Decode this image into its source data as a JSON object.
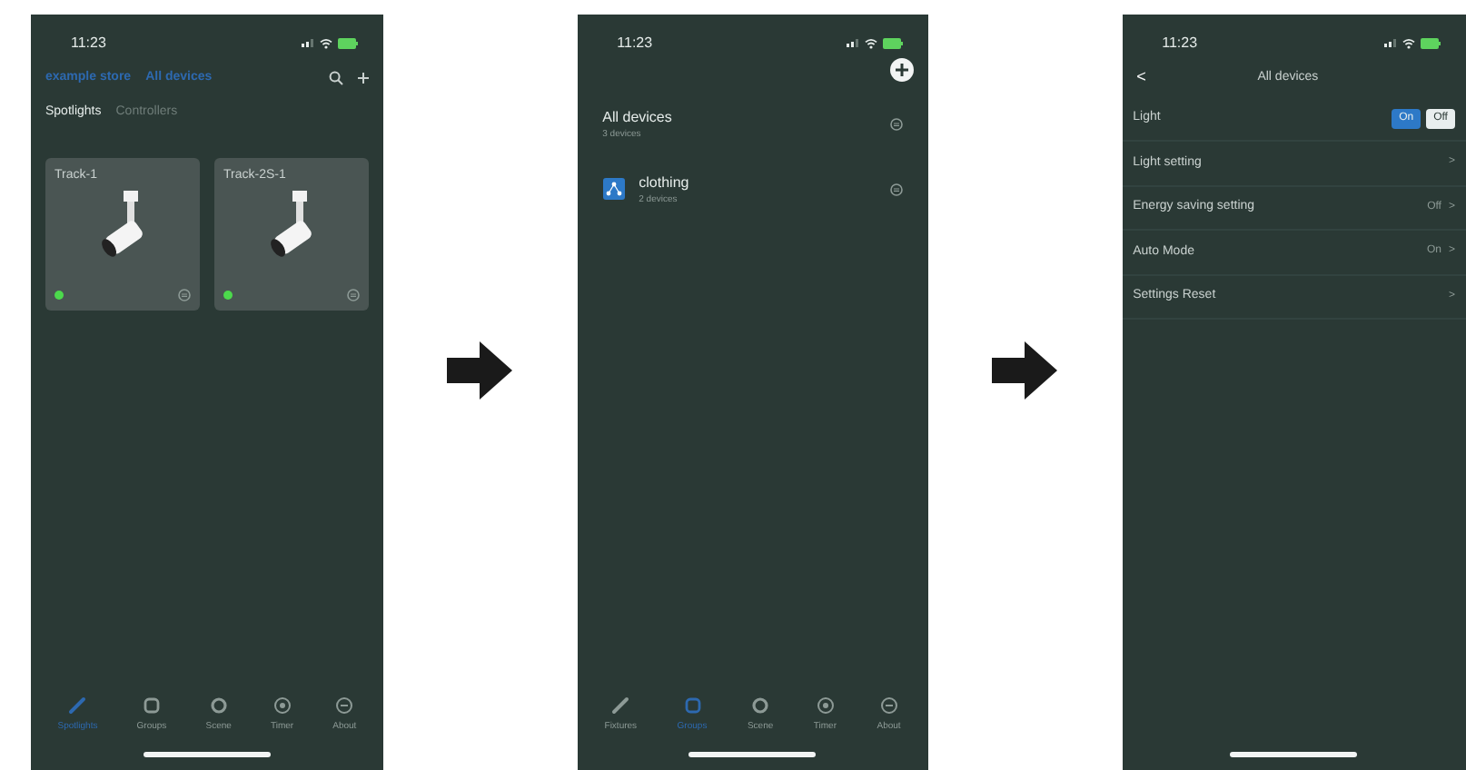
{
  "screens": [
    {
      "kind": "devices",
      "time": "11:23",
      "store": "example store",
      "title": "All devices",
      "tabs": [
        {
          "label": "Spotlights",
          "selected": true
        },
        {
          "label": "Controllers",
          "selected": false
        }
      ],
      "cards": [
        {
          "name": "Track-1",
          "online": true
        },
        {
          "name": "Track-2S-1",
          "online": true
        }
      ],
      "nav": [
        {
          "label": "Spotlights",
          "selected": true
        },
        {
          "label": "Groups",
          "selected": false
        },
        {
          "label": "Scene",
          "selected": false
        },
        {
          "label": "Timer",
          "selected": false
        },
        {
          "label": "About",
          "selected": false
        }
      ]
    },
    {
      "kind": "groups",
      "time": "11:23",
      "groups": [
        {
          "name": "All devices",
          "count": "3 devices",
          "icon": false
        },
        {
          "name": "clothing",
          "count": "2 devices",
          "icon": true
        }
      ],
      "nav": [
        {
          "label": "Fixtures",
          "selected": false
        },
        {
          "label": "Groups",
          "selected": true
        },
        {
          "label": "Scene",
          "selected": false
        },
        {
          "label": "Timer",
          "selected": false
        },
        {
          "label": "About",
          "selected": false
        }
      ]
    },
    {
      "kind": "settings",
      "time": "11:23",
      "back": "<",
      "title": "All devices",
      "light": {
        "label": "Light",
        "options": [
          {
            "label": "On",
            "selected": true
          },
          {
            "label": "Off",
            "selected": false
          }
        ]
      },
      "rows": [
        {
          "label": "Light setting",
          "chevron": ">"
        },
        {
          "label": "Energy saving setting",
          "value": "Off",
          "chevron": ">"
        },
        {
          "label": "Auto Mode",
          "value": "On",
          "chevron": ">"
        },
        {
          "label": "Settings Reset",
          "chevron": ">"
        }
      ]
    }
  ]
}
